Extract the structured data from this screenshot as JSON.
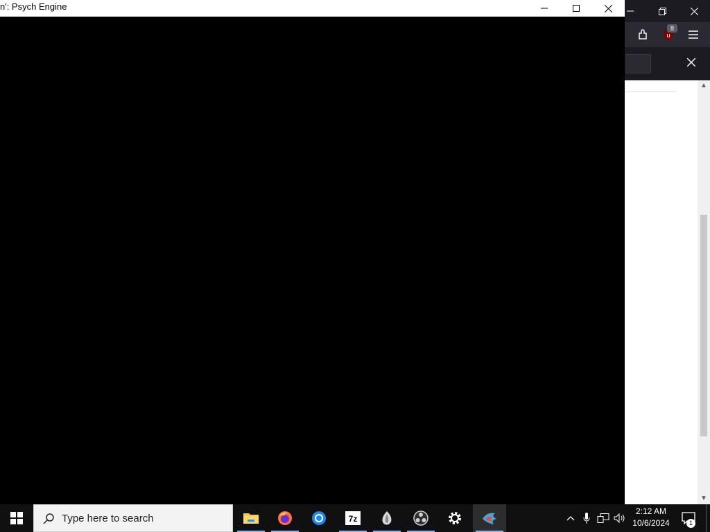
{
  "app_window": {
    "title": "n': Psych Engine"
  },
  "browser": {
    "extension_badge": "8"
  },
  "taskbar": {
    "search_placeholder": "Type here to search",
    "clock_time": "2:12 AM",
    "clock_date": "10/6/2024",
    "notification_count": "1",
    "pinned_apps": [
      "file-explorer",
      "firefox",
      "chrome",
      "7-zip",
      "app-teardrop",
      "obs-studio",
      "settings",
      "psych-engine"
    ],
    "active_app": "psych-engine"
  },
  "colors": {
    "taskbar_bg": "#101010",
    "app_canvas": "#000000",
    "browser_chrome": "#1c1b22",
    "active_indicator": "#8ab4f8"
  }
}
